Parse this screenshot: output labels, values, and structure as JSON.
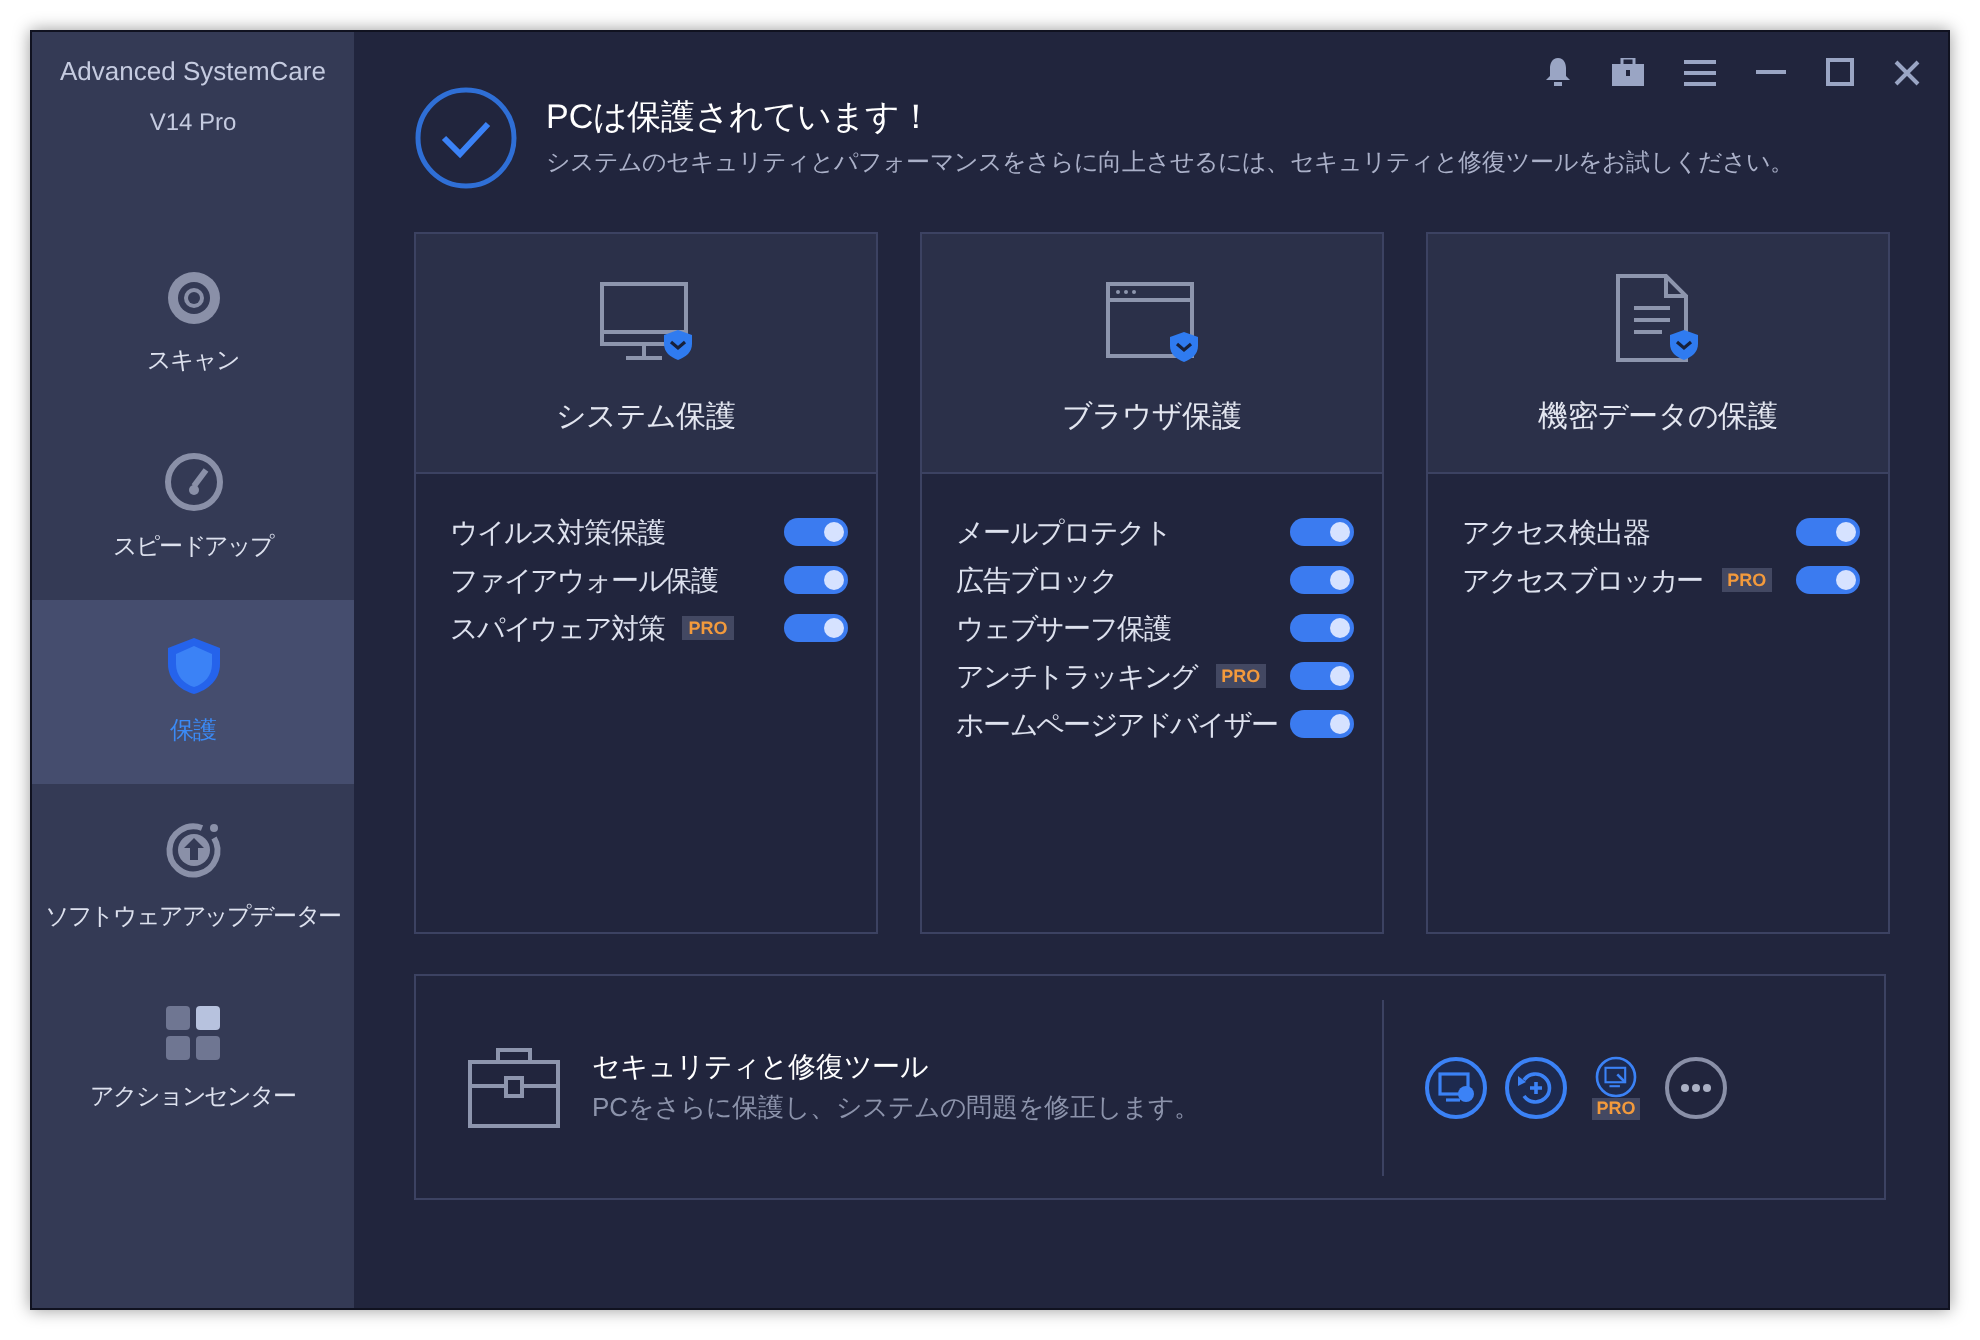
{
  "app": {
    "name": "Advanced SystemCare",
    "version": "V14 Pro"
  },
  "sidebar": {
    "items": [
      {
        "label": "スキャン",
        "kind": "scan",
        "selected": false
      },
      {
        "label": "スピードアップ",
        "kind": "speed",
        "selected": false
      },
      {
        "label": "保護",
        "kind": "shield",
        "selected": true
      },
      {
        "label": "ソフトウェアアップデーター",
        "kind": "update",
        "selected": false
      },
      {
        "label": "アクションセンター",
        "kind": "grid",
        "selected": false
      }
    ]
  },
  "titlebar": {
    "buttons": [
      {
        "kind": "bell"
      },
      {
        "kind": "briefcase"
      },
      {
        "kind": "menu"
      },
      {
        "kind": "minimize"
      },
      {
        "kind": "maximize"
      },
      {
        "kind": "close"
      }
    ]
  },
  "status": {
    "title": "PCは保護されています！",
    "subtitle": "システムのセキュリティとパフォーマンスをさらに向上させるには、セキュリティと修復ツールをお試しください。"
  },
  "cards": [
    {
      "title": "システム保護",
      "kind": "monitor",
      "items": [
        {
          "label": "ウイルス対策保護",
          "on": true
        },
        {
          "label": "ファイアウォール保護",
          "on": true
        },
        {
          "label": "スパイウェア対策",
          "badge": "PRO",
          "on": true
        }
      ]
    },
    {
      "title": "ブラウザ保護",
      "kind": "browser",
      "items": [
        {
          "label": "メールプロテクト",
          "on": true
        },
        {
          "label": "広告ブロック",
          "on": true
        },
        {
          "label": "ウェブサーフ保護",
          "on": true
        },
        {
          "label": "アンチトラッキング",
          "badge": "PRO",
          "on": true
        },
        {
          "label": "ホームページアドバイザー",
          "on": true
        }
      ]
    },
    {
      "title": "機密データの保護",
      "kind": "document",
      "items": [
        {
          "label": "アクセス検出器",
          "on": true
        },
        {
          "label": "アクセスブロッカー",
          "badge": "PRO",
          "on": true
        }
      ]
    }
  ],
  "tools": {
    "title": "セキュリティと修復ツール",
    "subtitle": "PCをさらに保護し、システムの問題を修正します。",
    "buttons": [
      {
        "kind": "monitor-shield"
      },
      {
        "kind": "restore"
      },
      {
        "kind": "monitor-wrench",
        "badge": "PRO"
      },
      {
        "kind": "more"
      }
    ]
  }
}
